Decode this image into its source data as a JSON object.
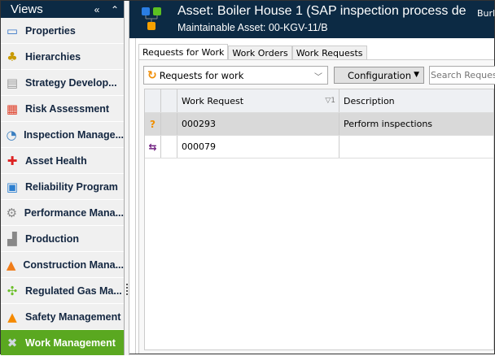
{
  "sidebar": {
    "title": "Views",
    "collapse_icon": "«",
    "up_icon": "⌃",
    "items": [
      {
        "label": "Properties",
        "icon": "▭",
        "color": "#3a78c8"
      },
      {
        "label": "Hierarchies",
        "icon": "♣",
        "color": "#c89a00"
      },
      {
        "label": "Strategy Develop...",
        "icon": "▤",
        "color": "#999"
      },
      {
        "label": "Risk Assessment",
        "icon": "▦",
        "color": "#e0402a"
      },
      {
        "label": "Inspection Manage...",
        "icon": "◔",
        "color": "#3b7fc0"
      },
      {
        "label": "Asset Health",
        "icon": "✚",
        "color": "#d22"
      },
      {
        "label": "Reliability Program",
        "icon": "▣",
        "color": "#2c7fd0"
      },
      {
        "label": "Performance Mana...",
        "icon": "⚙",
        "color": "#888"
      },
      {
        "label": "Production",
        "icon": "▟",
        "color": "#888"
      },
      {
        "label": "Construction Mana...",
        "icon": "▲",
        "color": "#f07d1a"
      },
      {
        "label": "Regulated Gas Ma...",
        "icon": "✣",
        "color": "#6cbf2a"
      },
      {
        "label": "Safety Management",
        "icon": "▲",
        "color": "#f58a00"
      },
      {
        "label": "Work Management",
        "icon": "✖",
        "color": "#cfd8e0",
        "selected": true
      }
    ]
  },
  "header": {
    "title": "Asset: Boiler House 1 (SAP inspection process de",
    "subtitle": "Maintainable Asset:  00-KGV-11/B",
    "right_text": "Burli"
  },
  "tabs": [
    {
      "label": "Requests for Work",
      "active": true
    },
    {
      "label": "Work Orders"
    },
    {
      "label": "Work Requests"
    }
  ],
  "toolbar": {
    "query": "Requests for work",
    "config_label": "Configuration",
    "search_placeholder": "Search Requests"
  },
  "grid": {
    "columns": [
      "Work Request",
      "Description"
    ],
    "sort_indicator": "▽1",
    "rows": [
      {
        "icon": "?",
        "work_request": "000293",
        "description": "Perform inspections",
        "selected": true
      },
      {
        "icon": "⇆",
        "work_request": "000079",
        "description": ""
      }
    ]
  }
}
